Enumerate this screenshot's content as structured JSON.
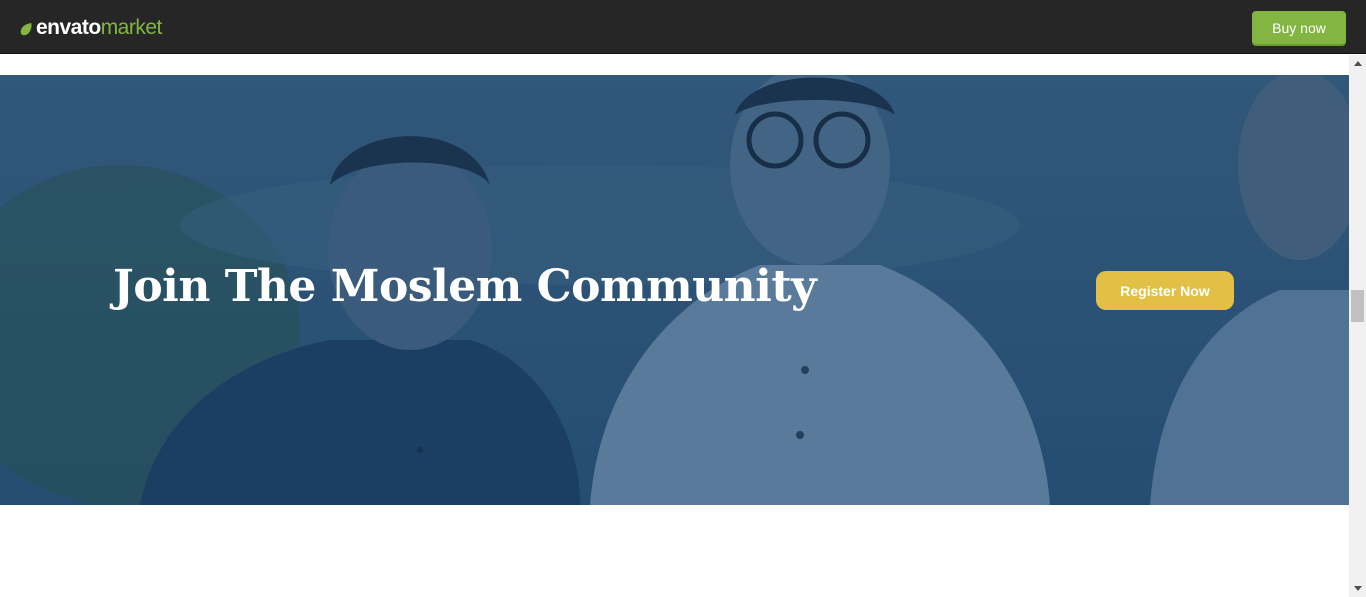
{
  "topbar": {
    "logo": {
      "brand": "envato",
      "product": "market"
    },
    "buy_label": "Buy now"
  },
  "hero": {
    "title": "Join The Moslem Community",
    "register_label": "Register Now"
  },
  "colors": {
    "topbar_bg": "#262626",
    "brand_green": "#82b541",
    "register_yellow": "#e2c045",
    "hero_overlay": "#2d5578"
  },
  "icons": {
    "logo_leaf": "leaf-icon",
    "scroll_up": "chevron-up-icon",
    "scroll_down": "chevron-down-icon"
  }
}
